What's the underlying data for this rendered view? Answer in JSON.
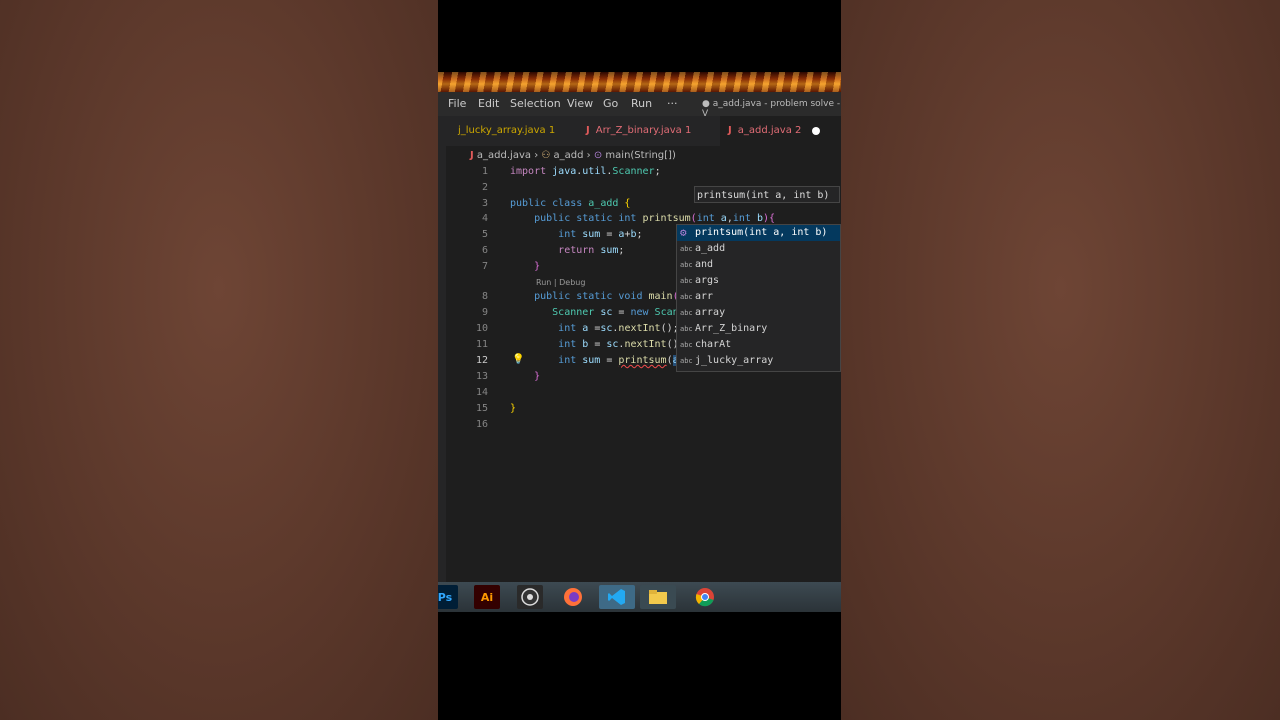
{
  "menu": {
    "file": "File",
    "edit": "Edit",
    "selection": "Selection",
    "view": "View",
    "go": "Go",
    "run": "Run",
    "more": "···",
    "window_title": "● a_add.java - problem solve - V"
  },
  "tabs": [
    {
      "label": "j_lucky_array.java 1",
      "color": "#cca700"
    },
    {
      "label": "Arr_Z_binary.java 1",
      "color": "#e06c75"
    },
    {
      "label": "a_add.java 2",
      "color": "#e06c75"
    }
  ],
  "breadcrumb": {
    "file": "a_add.java",
    "cls": "a_add",
    "method": "main(String[])"
  },
  "line_numbers": [
    "1",
    "2",
    "3",
    "4",
    "5",
    "6",
    "7",
    "8",
    "9",
    "10",
    "11",
    "12",
    "13",
    "14",
    "15",
    "16"
  ],
  "codelens": "Run | Debug",
  "param_hint": "printsum(int a, int b)",
  "suggestions": [
    {
      "icon": "⚙",
      "label": "printsum(int a, int b)",
      "selected": true
    },
    {
      "icon": "abc",
      "label": "a_add"
    },
    {
      "icon": "abc",
      "label": "and"
    },
    {
      "icon": "abc",
      "label": "args"
    },
    {
      "icon": "abc",
      "label": "arr"
    },
    {
      "icon": "abc",
      "label": "array"
    },
    {
      "icon": "abc",
      "label": "Arr_Z_binary"
    },
    {
      "icon": "abc",
      "label": "charAt"
    },
    {
      "icon": "abc",
      "label": "j_lucky_array"
    }
  ],
  "taskbar": {
    "ps": "Ps",
    "ai": "Ai"
  }
}
